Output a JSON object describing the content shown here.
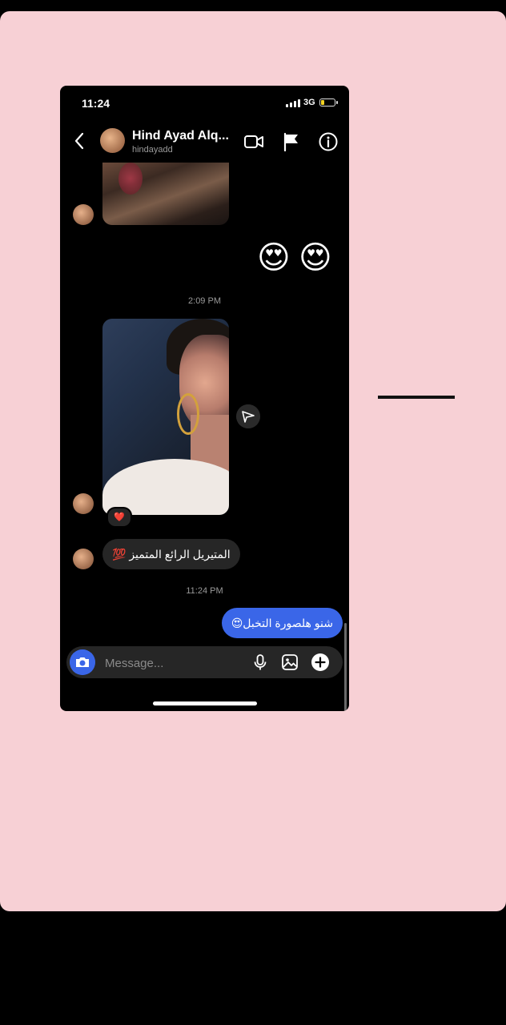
{
  "status_bar": {
    "time": "11:24",
    "network": "3G",
    "battery_level": 0.25
  },
  "header": {
    "contact_name": "Hind Ayad Alq...",
    "contact_username": "hindayadd",
    "icons": [
      "back-icon",
      "video-call-icon",
      "flag-icon",
      "info-icon"
    ]
  },
  "thread": {
    "emoji_message": [
      "😍",
      "😍"
    ],
    "timestamp_1": "2:09 PM",
    "reaction": "❤️",
    "incoming_text": "المتيريل الرائع المتميز 💯",
    "timestamp_2": "11:24 PM",
    "outgoing_text": "شنو هلصورة التخبل😍"
  },
  "composer": {
    "placeholder": "Message..."
  },
  "colors": {
    "accent": "#3a66e8",
    "bubble_incoming": "#262626",
    "background": "#f7d0d5"
  }
}
